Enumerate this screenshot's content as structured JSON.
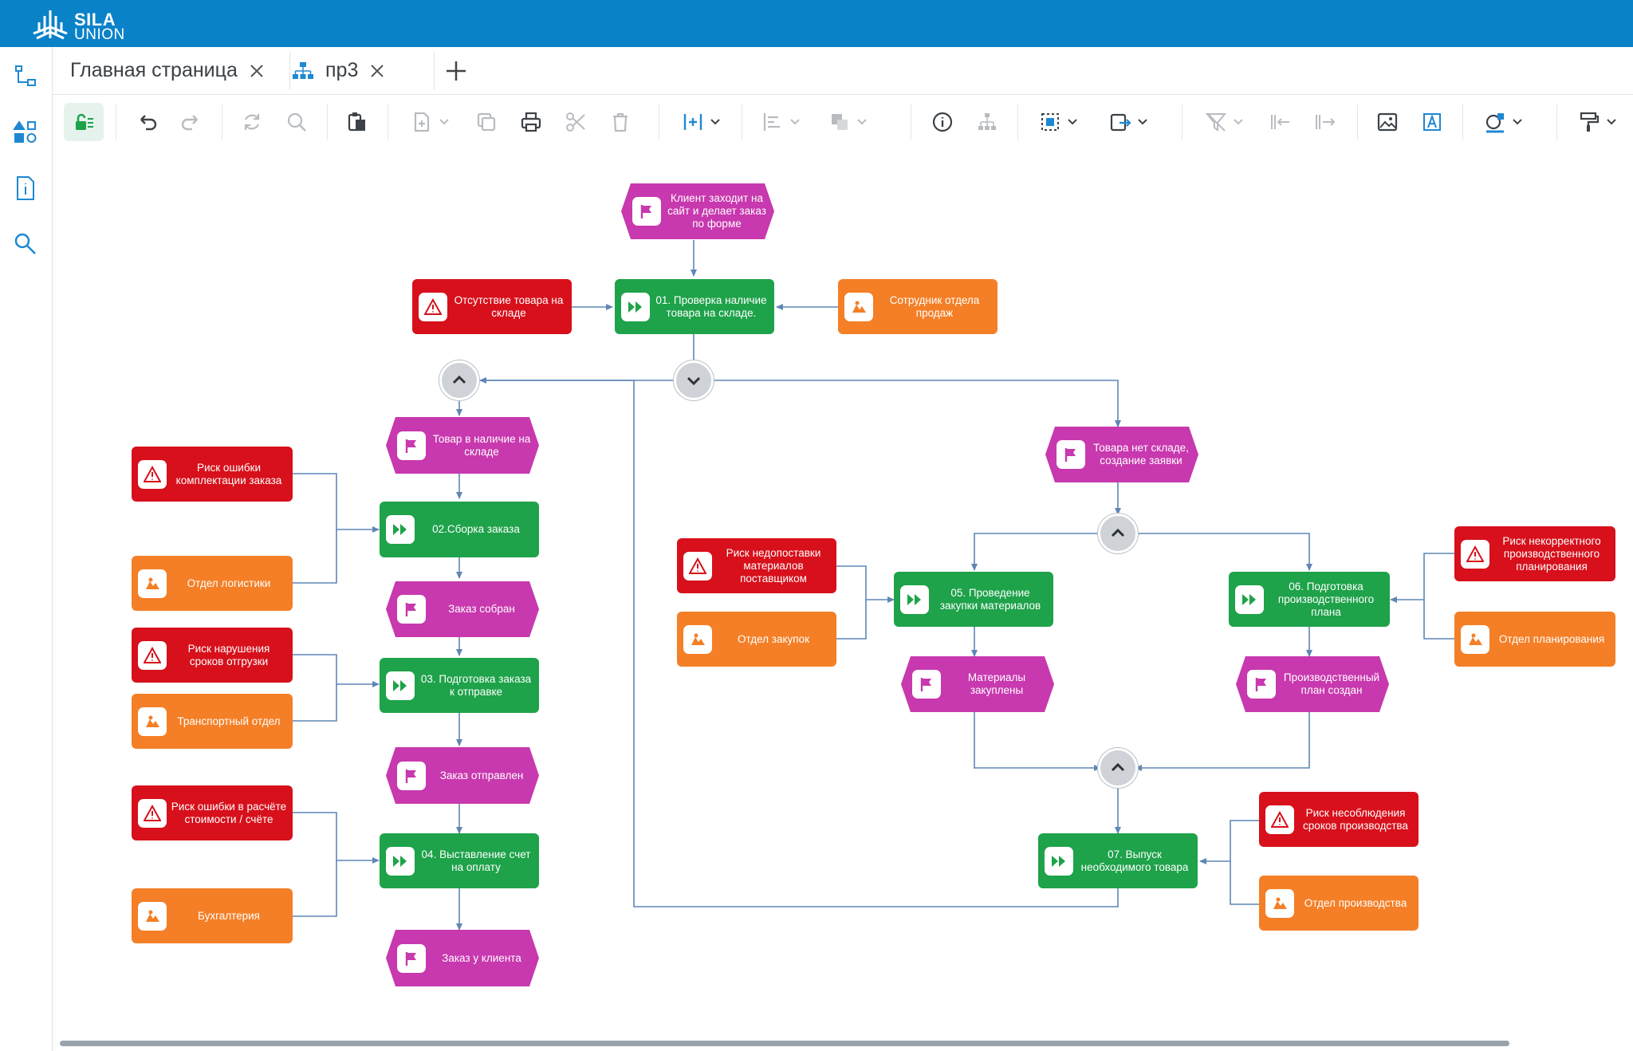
{
  "app": {
    "logo_line1": "SILA",
    "logo_line2": "UNION",
    "brand_color": "#0a82c8"
  },
  "tabs": [
    {
      "label": "Главная страница"
    },
    {
      "label": "пр3"
    }
  ],
  "colors": {
    "function": "#1ea24a",
    "event": "#c838ae",
    "risk": "#d7101b",
    "org_unit": "#f47f26",
    "connector": "#5f86b6",
    "gateway": "#cfd3d8"
  },
  "sidebar": {
    "items": [
      {
        "icon": "model-tree-icon"
      },
      {
        "icon": "shapes-icon"
      },
      {
        "icon": "document-info-icon"
      },
      {
        "icon": "search-icon"
      }
    ]
  },
  "toolbar": {
    "items": [
      "lock-edit-icon",
      "undo-icon",
      "redo-icon",
      "refresh-icon",
      "zoom-icon",
      "paste-icon",
      "new-object-icon",
      "copy-format-icon",
      "print-icon",
      "cut-icon",
      "delete-icon",
      "insert-icon",
      "align-icon",
      "arrange-icon",
      "info-icon",
      "hierarchy-icon",
      "select-icon",
      "export-icon",
      "filter-icon",
      "move-left-icon",
      "move-right-icon",
      "image-icon",
      "text-frame-icon",
      "shape-style-icon",
      "format-painter-icon"
    ]
  },
  "diagram": {
    "nodes": {
      "e_start": "Клиент заходит на сайт и делает заказ по форме",
      "r_notstock": "Отсутствие товара на складе",
      "f01": "01. Проверка наличие товара на складе.",
      "o_sales": "Сотрудник отдела продаж",
      "e_instock": "Товар в наличие на складе",
      "r_picking": "Риск ошибки комплектации заказа",
      "f02": "02.Сборка заказа",
      "o_logistics": "Отдел логистики",
      "e_assembled": "Заказ собран",
      "r_shipdelay": "Риск нарушения сроков отгрузки",
      "f03": "03. Подготовка заказа к отправке",
      "o_transport": "Транспортный отдел",
      "e_sent": "Заказ отправлен",
      "r_calc": "Риск ошибки в расчёте стоимости / счёте",
      "f04": "04. Выставление счет на оплату",
      "o_accounting": "Бухгалтерия",
      "e_client": "Заказ у клиента",
      "e_nostock": "Товара нет складе, создание заявки",
      "r_supply": "Риск недопоставки материалов поставщиком",
      "o_purchase": "Отдел закупок",
      "f05": "05. Проведение закупки материалов",
      "e_materials": "Материалы закуплены",
      "f06": "06. Подготовка производственного плана",
      "r_planning": "Риск некорректного производственного планирования",
      "o_planning": "Отдел планирования",
      "e_plan": "Производственный план создан",
      "f07": "07. Выпуск необходимого товара",
      "r_prod": "Риск несоблюдения сроков производства",
      "o_prod": "Отдел производства"
    }
  }
}
